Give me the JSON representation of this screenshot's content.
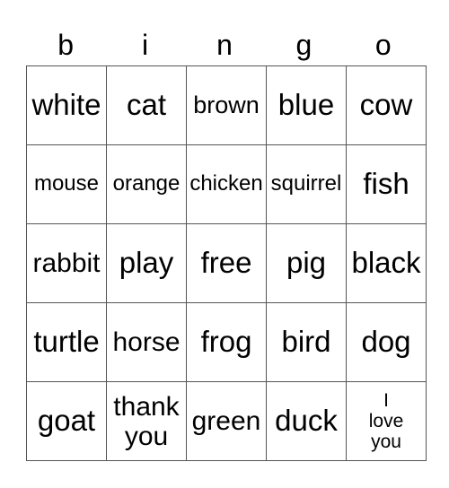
{
  "header": [
    "b",
    "i",
    "n",
    "g",
    "o"
  ],
  "rows": [
    [
      {
        "text": "white",
        "size": "s33"
      },
      {
        "text": "cat",
        "size": "s33"
      },
      {
        "text": "brown",
        "size": "s27"
      },
      {
        "text": "blue",
        "size": "s33"
      },
      {
        "text": "cow",
        "size": "s33"
      }
    ],
    [
      {
        "text": "mouse",
        "size": "s24"
      },
      {
        "text": "orange",
        "size": "s24"
      },
      {
        "text": "chicken",
        "size": "s24"
      },
      {
        "text": "squirrel",
        "size": "s24"
      },
      {
        "text": "fish",
        "size": "s33"
      }
    ],
    [
      {
        "text": "rabbit",
        "size": "s30"
      },
      {
        "text": "play",
        "size": "s33"
      },
      {
        "text": "free",
        "size": "s33"
      },
      {
        "text": "pig",
        "size": "s33"
      },
      {
        "text": "black",
        "size": "s33"
      }
    ],
    [
      {
        "text": "turtle",
        "size": "s33"
      },
      {
        "text": "horse",
        "size": "s30"
      },
      {
        "text": "frog",
        "size": "s33"
      },
      {
        "text": "bird",
        "size": "s33"
      },
      {
        "text": "dog",
        "size": "s33"
      }
    ],
    [
      {
        "text": "goat",
        "size": "s33"
      },
      {
        "text": "thank you",
        "size": "s30",
        "lines": [
          "thank",
          "you"
        ]
      },
      {
        "text": "green",
        "size": "s30"
      },
      {
        "text": "duck",
        "size": "s33"
      },
      {
        "text": "I love you",
        "size": "s21",
        "lines": [
          "I",
          "love",
          "you"
        ]
      }
    ]
  ]
}
